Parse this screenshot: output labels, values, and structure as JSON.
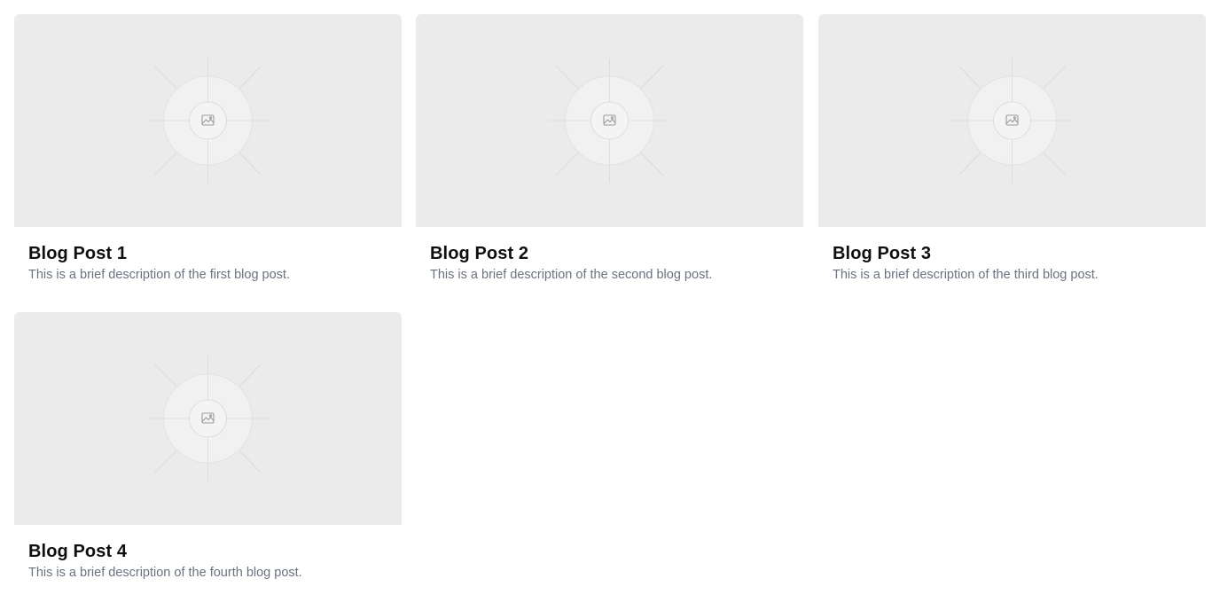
{
  "posts": [
    {
      "title": "Blog Post 1",
      "description": "This is a brief description of the first blog post.",
      "image_icon": "image-placeholder-icon"
    },
    {
      "title": "Blog Post 2",
      "description": "This is a brief description of the second blog post.",
      "image_icon": "image-placeholder-icon"
    },
    {
      "title": "Blog Post 3",
      "description": "This is a brief description of the third blog post.",
      "image_icon": "image-placeholder-icon"
    },
    {
      "title": "Blog Post 4",
      "description": "This is a brief description of the fourth blog post.",
      "image_icon": "image-placeholder-icon"
    }
  ],
  "colors": {
    "placeholder_bg": "#ebebeb",
    "title": "#0f0f10",
    "description": "#6b7280"
  }
}
